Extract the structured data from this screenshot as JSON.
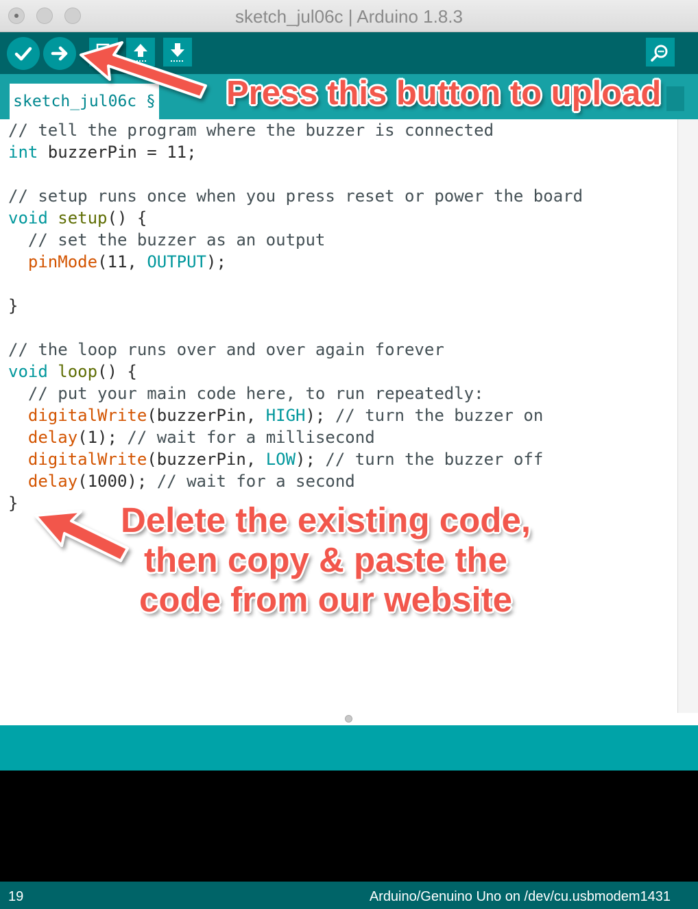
{
  "window": {
    "title": "sketch_jul06c | Arduino 1.8.3"
  },
  "toolbar": {
    "buttons": [
      {
        "name": "verify",
        "icon": "checkmark-icon"
      },
      {
        "name": "upload",
        "icon": "right-arrow-icon"
      },
      {
        "name": "new",
        "icon": "new-file-icon"
      },
      {
        "name": "open",
        "icon": "up-arrow-icon"
      },
      {
        "name": "save",
        "icon": "down-arrow-icon"
      },
      {
        "name": "serial-monitor",
        "icon": "magnifier-icon"
      }
    ]
  },
  "tabs": [
    {
      "label": "sketch_jul06c §"
    }
  ],
  "editor": {
    "lines": [
      [
        [
          "cm",
          "// tell the program where the buzzer is connected"
        ]
      ],
      [
        [
          "kw",
          "int"
        ],
        [
          "",
          " buzzerPin = 11;"
        ]
      ],
      [],
      [
        [
          "cm",
          "// setup runs once when you press reset or power the board"
        ]
      ],
      [
        [
          "kw",
          "void"
        ],
        [
          "",
          " "
        ],
        [
          "fn",
          "setup"
        ],
        [
          "",
          "() {"
        ]
      ],
      [
        [
          "cm",
          "  // set the buzzer as an output"
        ]
      ],
      [
        [
          "",
          "  "
        ],
        [
          "fn2",
          "pinMode"
        ],
        [
          "",
          "(11, "
        ],
        [
          "cst",
          "OUTPUT"
        ],
        [
          "",
          ");"
        ]
      ],
      [],
      [
        [
          "",
          "}"
        ]
      ],
      [],
      [
        [
          "cm",
          "// the loop runs over and over again forever"
        ]
      ],
      [
        [
          "kw",
          "void"
        ],
        [
          "",
          " "
        ],
        [
          "fn",
          "loop"
        ],
        [
          "",
          "() {"
        ]
      ],
      [
        [
          "cm",
          "  // put your main code here, to run repeatedly:"
        ]
      ],
      [
        [
          "",
          "  "
        ],
        [
          "fn2",
          "digitalWrite"
        ],
        [
          "",
          "(buzzerPin, "
        ],
        [
          "cst",
          "HIGH"
        ],
        [
          "",
          "); "
        ],
        [
          "cm",
          "// turn the buzzer on"
        ]
      ],
      [
        [
          "",
          "  "
        ],
        [
          "fn2",
          "delay"
        ],
        [
          "",
          "(1); "
        ],
        [
          "cm",
          "// wait for a millisecond"
        ]
      ],
      [
        [
          "",
          "  "
        ],
        [
          "fn2",
          "digitalWrite"
        ],
        [
          "",
          "(buzzerPin, "
        ],
        [
          "cst",
          "LOW"
        ],
        [
          "",
          "); "
        ],
        [
          "cm",
          "// turn the buzzer off"
        ]
      ],
      [
        [
          "",
          "  "
        ],
        [
          "fn2",
          "delay"
        ],
        [
          "",
          "(1000); "
        ],
        [
          "cm",
          "// wait for a second"
        ]
      ],
      [
        [
          "",
          "}"
        ]
      ]
    ]
  },
  "annotations": {
    "upload": "Press this button to upload",
    "delete": [
      "Delete the existing code,",
      "then copy & paste the",
      "code from our website"
    ]
  },
  "status": {
    "line": "19",
    "board": "Arduino/Genuino Uno on /dev/cu.usbmodem1431"
  },
  "colors": {
    "toolbar": "#006468",
    "button": "#00979c",
    "tabstrip": "#17a1a5",
    "annotation": "#f2574c"
  }
}
